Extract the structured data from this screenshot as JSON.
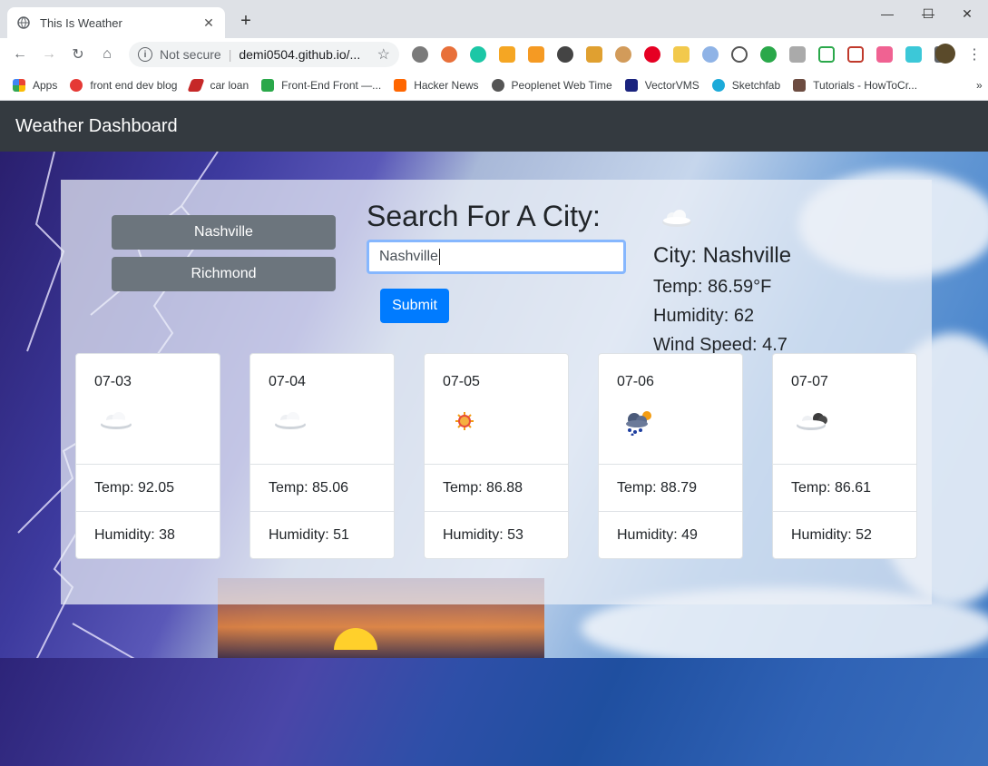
{
  "browser": {
    "tab_title": "This Is Weather",
    "security_label": "Not secure",
    "url": "demi0504.github.io/...",
    "bookmarks": [
      {
        "label": "Apps"
      },
      {
        "label": "front end dev blog"
      },
      {
        "label": "car loan"
      },
      {
        "label": "Front-End Front —..."
      },
      {
        "label": "Hacker News"
      },
      {
        "label": "Peoplenet Web Time"
      },
      {
        "label": "VectorVMS"
      },
      {
        "label": "Sketchfab"
      },
      {
        "label": "Tutorials - HowToCr..."
      }
    ],
    "more_bookmarks": "»"
  },
  "navbar": {
    "brand": "Weather Dashboard"
  },
  "history": {
    "cities": [
      "Nashville",
      "Richmond"
    ]
  },
  "search": {
    "heading": "Search For A City:",
    "value": "Nashville",
    "submit_label": "Submit"
  },
  "current": {
    "icon": "few-clouds-icon",
    "city": "City: Nashville",
    "temp": "Temp: 86.59°F",
    "humidity": "Humidity: 62",
    "wind": "Wind Speed: 4.7"
  },
  "forecast": [
    {
      "date": "07-03",
      "icon": "cloud-icon",
      "temp": "Temp: 92.05",
      "humidity": "Humidity: 38"
    },
    {
      "date": "07-04",
      "icon": "cloud-icon",
      "temp": "Temp: 85.06",
      "humidity": "Humidity: 51"
    },
    {
      "date": "07-05",
      "icon": "sun-icon",
      "temp": "Temp: 86.88",
      "humidity": "Humidity: 53"
    },
    {
      "date": "07-06",
      "icon": "rain-sun-icon",
      "temp": "Temp: 88.79",
      "humidity": "Humidity: 49"
    },
    {
      "date": "07-07",
      "icon": "broken-clouds-icon",
      "temp": "Temp: 86.61",
      "humidity": "Humidity: 52"
    }
  ]
}
